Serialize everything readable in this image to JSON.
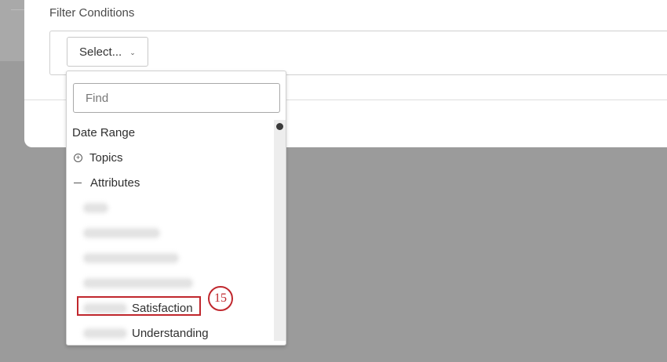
{
  "filter_section": {
    "label": "Filter Conditions",
    "select_button": {
      "label": "Select...",
      "icon": "chevron-down-icon"
    }
  },
  "dropdown": {
    "search": {
      "placeholder": "Find",
      "value": ""
    },
    "items": [
      {
        "label": "Date Range",
        "type": "item"
      },
      {
        "label": "Topics",
        "type": "group",
        "icon": "plus-circle-icon",
        "expanded": false
      },
      {
        "label": "Attributes",
        "type": "group",
        "icon": "minus-icon",
        "expanded": true
      }
    ],
    "attribute_children": [
      {
        "label": ""
      },
      {
        "label": ""
      },
      {
        "label": ""
      },
      {
        "label": ""
      },
      {
        "label": "Satisfaction"
      },
      {
        "label": "Understanding"
      }
    ]
  },
  "annotation": {
    "step": "15",
    "color": "#c0272d"
  }
}
